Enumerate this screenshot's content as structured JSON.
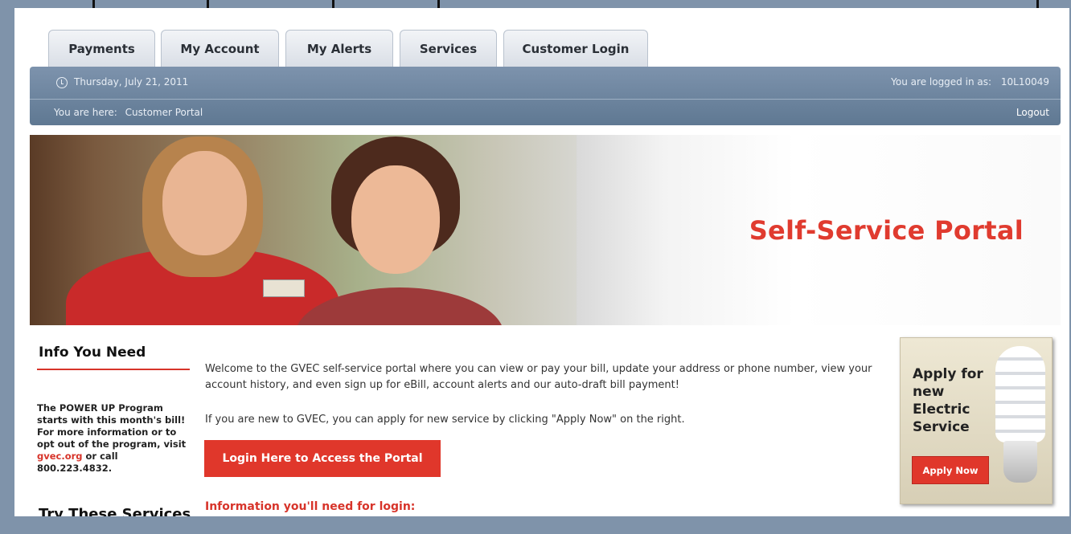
{
  "tabs": [
    {
      "label": "Payments"
    },
    {
      "label": "My Account"
    },
    {
      "label": "My Alerts"
    },
    {
      "label": "Services"
    },
    {
      "label": "Customer Login"
    }
  ],
  "header": {
    "date": "Thursday, July 21, 2011",
    "logged_in_label": "You are logged in as:",
    "account_id": "10L10049",
    "breadcrumb_label": "You are here:",
    "breadcrumb_current": "Customer Portal",
    "logout": "Logout"
  },
  "banner": {
    "title": "Self-Service Portal"
  },
  "info": {
    "heading": "Info You Need",
    "promo_text_1": "The POWER UP Program starts with this month's bill! For more information or to opt out of the program, visit ",
    "promo_link": "gvec.org",
    "promo_text_2": " or call 800.223.4832.",
    "try_heading": "Try These Services"
  },
  "main": {
    "welcome": "Welcome to the GVEC self-service portal where you can view or pay your bill, update your address or phone number, view your account history, and even sign up for eBill, account alerts and our auto-draft bill payment!",
    "new_service": "If you are new to GVEC, you can apply for new service by clicking \"Apply Now\" on the right.",
    "login_button": "Login Here to Access the Portal",
    "login_info_heading": "Information you'll need for login:"
  },
  "ad": {
    "title": "Apply for new Electric Service",
    "button": "Apply Now"
  },
  "colors": {
    "accent_red": "#e0372b",
    "header_blue": "#6c849f",
    "frame_blue": "#7f93aa"
  }
}
